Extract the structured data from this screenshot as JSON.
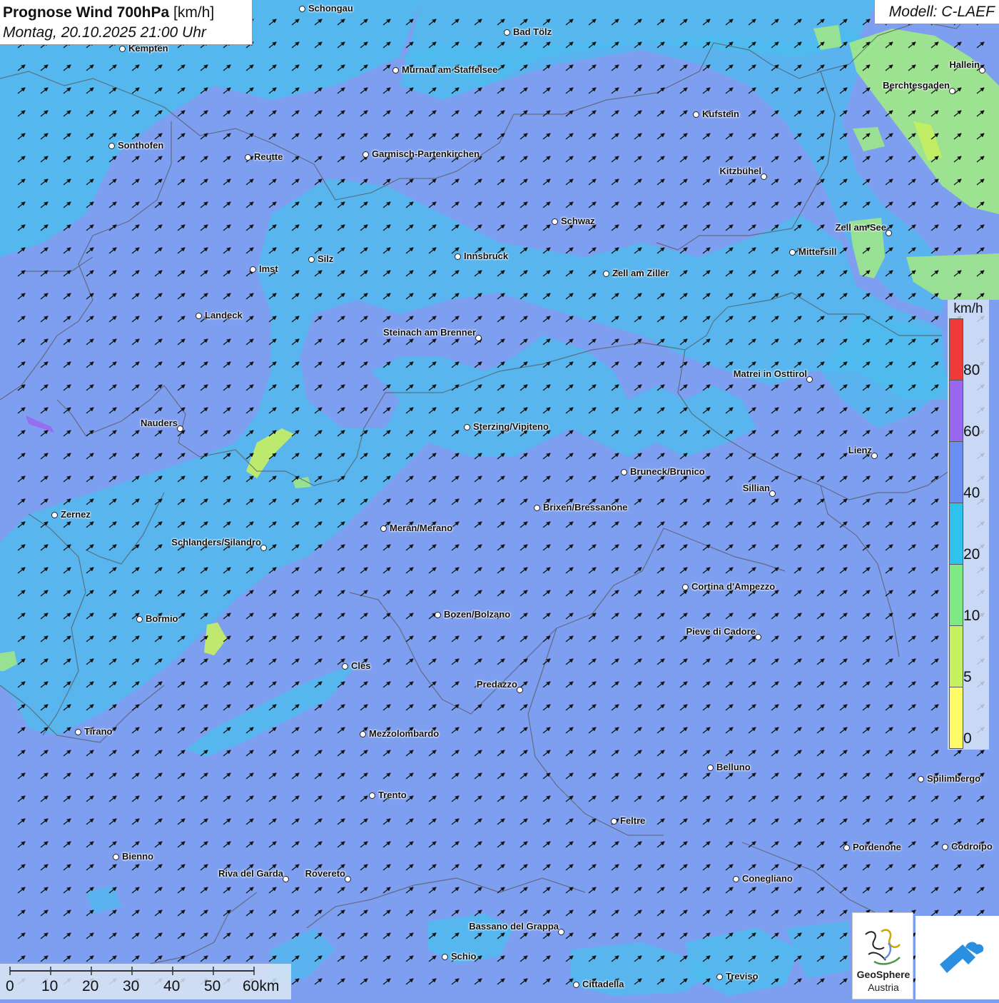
{
  "title": {
    "main_bold": "Prognose Wind 700hPa",
    "main_unit": "[km/h]",
    "subtitle": "Montag, 20.10.2025 21:00 Uhr"
  },
  "model": "Modell: C-LAEF",
  "legend": {
    "unit": "km/h",
    "ticks": [
      "80",
      "60",
      "40",
      "20",
      "10",
      "5",
      "0"
    ],
    "colors": [
      "#f03a3a",
      "#9966ee",
      "#6a8ef2",
      "#30c2ee",
      "#7de884",
      "#c7f060",
      "#fffb66"
    ]
  },
  "scale": {
    "labels": [
      "0",
      "10",
      "20",
      "30",
      "40",
      "50",
      "60km"
    ]
  },
  "logo": {
    "name": "GeoSphere",
    "sub": "Austria"
  },
  "cities": [
    {
      "name": "Schongau"
    },
    {
      "name": "Bad Tölz"
    },
    {
      "name": "Kempten"
    },
    {
      "name": "Murnau am Staffelsee"
    },
    {
      "name": "Hallein"
    },
    {
      "name": "Berchtesgaden"
    },
    {
      "name": "Kufstein"
    },
    {
      "name": "Sonthofen"
    },
    {
      "name": "Reutte"
    },
    {
      "name": "Garmisch-Partenkirchen"
    },
    {
      "name": "Kitzbühel"
    },
    {
      "name": "Schwaz"
    },
    {
      "name": "Zell am See"
    },
    {
      "name": "Mittersill"
    },
    {
      "name": "Innsbruck"
    },
    {
      "name": "Silz"
    },
    {
      "name": "Imst"
    },
    {
      "name": "Zell am Ziller"
    },
    {
      "name": "Landeck"
    },
    {
      "name": "Steinach am Brenner"
    },
    {
      "name": "Matrei in Osttirol"
    },
    {
      "name": "Nauders"
    },
    {
      "name": "Sterzing/Vipiteno"
    },
    {
      "name": "Lienz"
    },
    {
      "name": "Bruneck/Brunico"
    },
    {
      "name": "Sillian"
    },
    {
      "name": "Brixen/Bressanone"
    },
    {
      "name": "Zernez"
    },
    {
      "name": "Meran/Merano"
    },
    {
      "name": "Schlanders/Silandro"
    },
    {
      "name": "Cortina d'Ampezzo"
    },
    {
      "name": "Bozen/Bolzano"
    },
    {
      "name": "Bormio"
    },
    {
      "name": "Pieve di Cadore"
    },
    {
      "name": "Cles"
    },
    {
      "name": "Predazzo"
    },
    {
      "name": "Tirano"
    },
    {
      "name": "Mezzolombardo"
    },
    {
      "name": "Belluno"
    },
    {
      "name": "Spilimbergo"
    },
    {
      "name": "Trento"
    },
    {
      "name": "Feltre"
    },
    {
      "name": "Pordenone"
    },
    {
      "name": "Codroipo"
    },
    {
      "name": "Bienno"
    },
    {
      "name": "Riva del Garda"
    },
    {
      "name": "Rovereto"
    },
    {
      "name": "Conegliano"
    },
    {
      "name": "Bassano del Grappa"
    },
    {
      "name": "Schio"
    },
    {
      "name": "Treviso"
    },
    {
      "name": "Cittadella"
    }
  ]
}
